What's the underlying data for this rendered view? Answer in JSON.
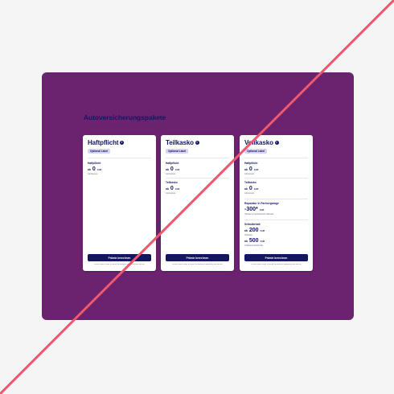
{
  "section_title": "Autoversicherungspakete",
  "packages": [
    {
      "title": "Haftpflicht",
      "badge": "Optional Label",
      "rows": [
        {
          "label": "Haftpflicht",
          "prefix": "ab",
          "value": "0",
          "unit": "CHF",
          "subtitle": "Jahrespreis"
        }
      ],
      "button": "Prämie berechnen",
      "note": "Lorem ipsum dolor sit amet consectetur adipiscing elit sed do"
    },
    {
      "title": "Teilkasko",
      "badge": "Optional Label",
      "rows": [
        {
          "label": "Haftpflicht",
          "prefix": "ab",
          "value": "0",
          "unit": "CHF",
          "subtitle": "Jahrespreis"
        },
        {
          "label": "Teilkasko",
          "prefix": "ab",
          "value": "0",
          "unit": "CHF",
          "subtitle": "Jahrespreis"
        }
      ],
      "button": "Prämie berechnen",
      "note": "Lorem ipsum dolor sit amet consectetur adipiscing elit sed do"
    },
    {
      "title": "Vollkasko",
      "badge": "Optional Label",
      "rows": [
        {
          "label": "Haftpflicht",
          "prefix": "ab",
          "value": "0",
          "unit": "CHF",
          "subtitle": "Jahrespreis"
        },
        {
          "label": "Teilkasko",
          "prefix": "ab",
          "value": "0",
          "unit": "CHF",
          "subtitle": "Jahrespreis"
        },
        {
          "label": "Reparatur in Partnergarage",
          "prefix": "",
          "value": "-300*",
          "unit": "CHF",
          "subtitle": "*Rabatt bei Selbstbehalt Vollkasko"
        },
        {
          "label": "Selbstbehalt",
          "prefix": "ab",
          "value": "200",
          "unit": "CHF",
          "subtitle": "Teilkasko"
        },
        {
          "label": "",
          "prefix": "ab",
          "value": "500",
          "unit": "CHF",
          "subtitle": "Vollkaskoselbstbehalt"
        }
      ],
      "button": "Prämie berechnen",
      "note": "Lorem ipsum dolor sit amet consectetur adipiscing elit sed do"
    }
  ],
  "colors": {
    "page_background": "#f5f5f5",
    "panel": "#6b236f",
    "navy": "#13185e",
    "badge_bg": "#d7d3f2",
    "cross_line": "#f0566c"
  }
}
